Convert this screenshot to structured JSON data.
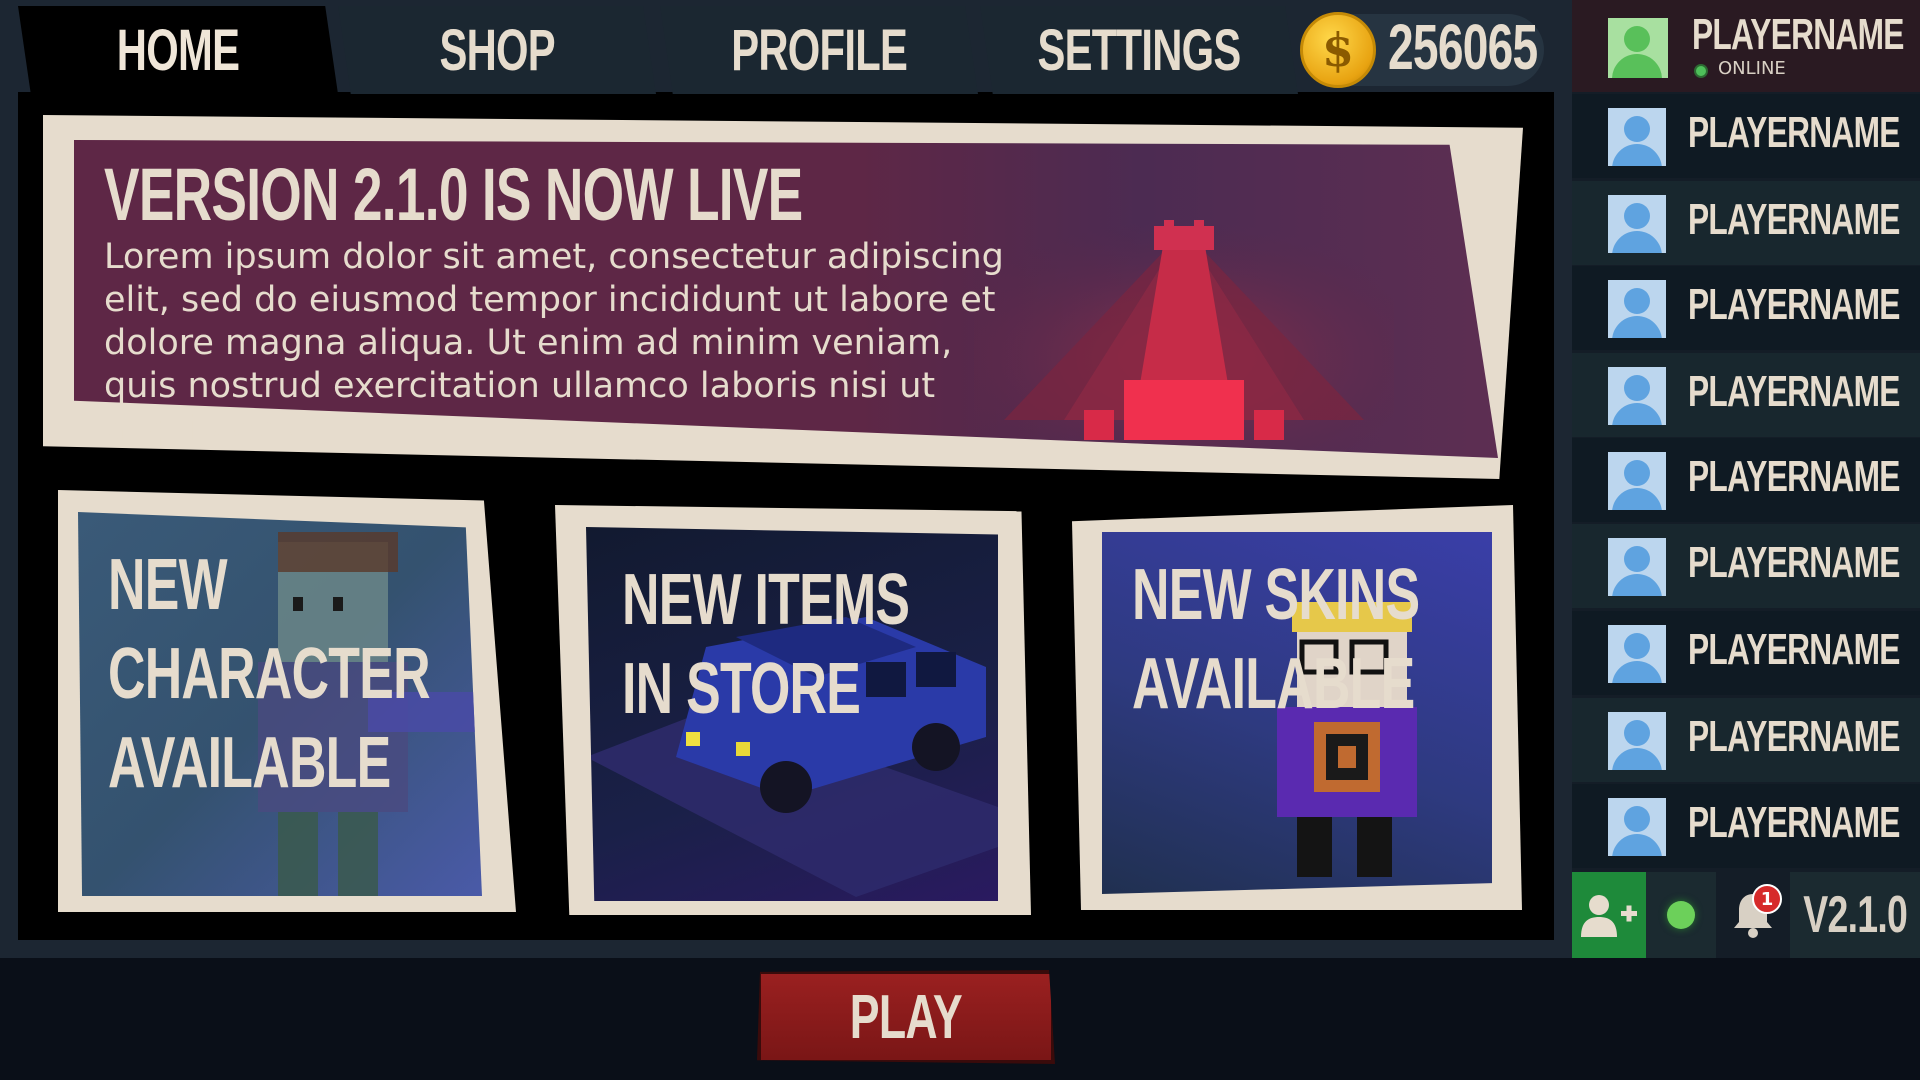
{
  "tabs": [
    {
      "label": "HOME",
      "active": true
    },
    {
      "label": "SHOP",
      "active": false
    },
    {
      "label": "PROFILE",
      "active": false
    },
    {
      "label": "SETTINGS",
      "active": false
    }
  ],
  "currency": {
    "icon": "coin-icon",
    "symbol": "$",
    "value": "256065"
  },
  "announcement": {
    "title": "VERSION 2.1.0 IS NOW LIVE",
    "body": "Lorem ipsum dolor sit amet, consectetur adipiscing elit, sed do eiusmod tempor incididunt ut labore et dolore magna aliqua. Ut enim ad minim veniam, quis nostrud exercitation ullamco laboris nisi ut aliquip ex ea"
  },
  "cards": [
    {
      "lines": [
        "NEW",
        "CHARACTER",
        "AVAILABLE"
      ]
    },
    {
      "lines": [
        "NEW ITEMS",
        "IN STORE"
      ]
    },
    {
      "lines": [
        "NEW SKINS",
        "AVAILABLE"
      ]
    }
  ],
  "play": {
    "label": "PLAY"
  },
  "me": {
    "name": "PLAYERNAME",
    "status": "ONLINE"
  },
  "friends": [
    "PLAYERNAME",
    "PLAYERNAME",
    "PLAYERNAME",
    "PLAYERNAME",
    "PLAYERNAME",
    "PLAYERNAME",
    "PLAYERNAME",
    "PLAYERNAME",
    "PLAYERNAME"
  ],
  "footer": {
    "notification_count": "1",
    "version": "V2.1.0"
  },
  "colors": {
    "accent_red": "#8a1c1c",
    "online_green": "#4ec05a",
    "cream": "#e6dccd",
    "banner_purple": "#5e2746"
  }
}
